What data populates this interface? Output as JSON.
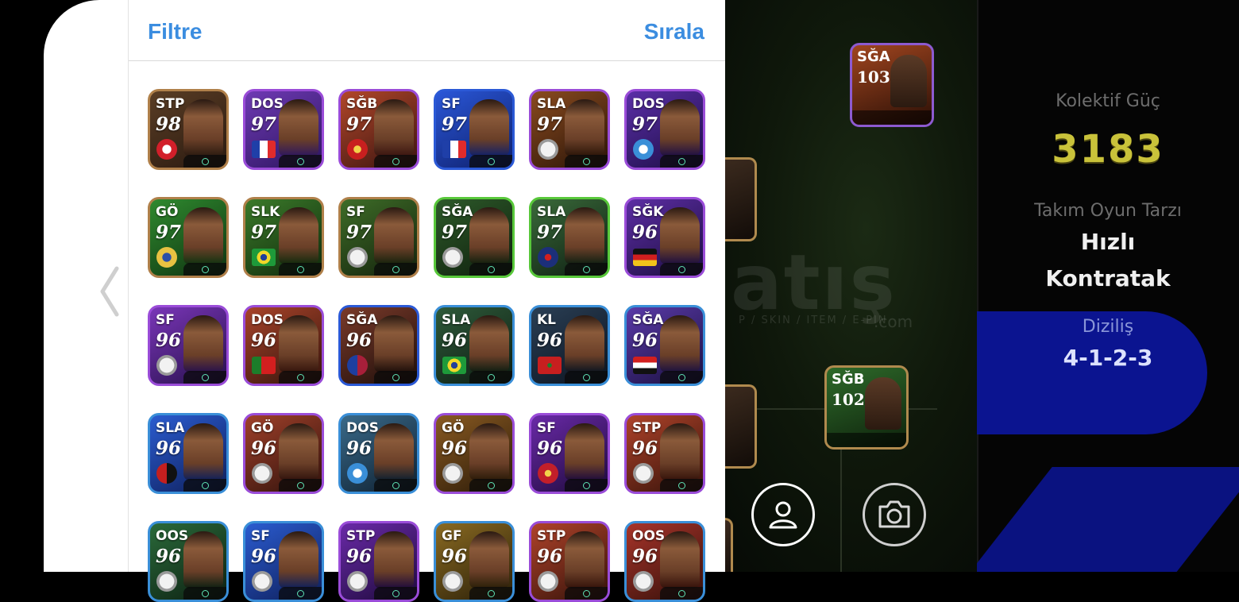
{
  "header": {
    "filter_label": "Filtre",
    "sort_label": "Sırala"
  },
  "side_panel": {
    "team_strength_label": "Kolektif Güç",
    "team_strength_value": "3183",
    "playstyle_label": "Takım Oyun Tarzı",
    "playstyle_line1": "Hızlı",
    "playstyle_line2": "Kontratak",
    "formation_label": "Diziliş",
    "formation_value": "4-1-2-3"
  },
  "field_cards": [
    {
      "position": "SĞA",
      "rating": "103"
    },
    {
      "position": "SĞB",
      "rating": "102"
    }
  ],
  "watermark": {
    "main": "atış",
    "sub": "P / SKIN / ITEM / E-PIN",
    "domain": ".com"
  },
  "icons": {
    "player_button": "person-icon",
    "camera_button": "camera-icon",
    "back": "chevron-left-icon"
  },
  "cards": [
    {
      "position": "STP",
      "rating": "98",
      "frame": "#b0804a",
      "bg": "#5a3d25",
      "bg2": "#2a1a10",
      "badge": "club-bayern"
    },
    {
      "position": "DOS",
      "rating": "97",
      "frame": "#9a4cd8",
      "bg": "#6f3ab4",
      "bg2": "#2c1560",
      "badge": "flag-france"
    },
    {
      "position": "SĞB",
      "rating": "97",
      "frame": "#9a4cd8",
      "bg": "#b2472a",
      "bg2": "#3a1410",
      "badge": "club-arsenal"
    },
    {
      "position": "SF",
      "rating": "97",
      "frame": "#2b59d6",
      "bg": "#2a57d8",
      "bg2": "#0e1f6b",
      "badge": "flag-france"
    },
    {
      "position": "SLA",
      "rating": "97",
      "frame": "#9a4cd8",
      "bg": "#8a4b1f",
      "bg2": "#2a1408",
      "badge": "club-white"
    },
    {
      "position": "DOS",
      "rating": "97",
      "frame": "#9a4cd8",
      "bg": "#5b2fa8",
      "bg2": "#1c0d45",
      "badge": "club-blue"
    },
    {
      "position": "GÖ",
      "rating": "97",
      "frame": "#b0804a",
      "bg": "#2f8a2f",
      "bg2": "#0f3310",
      "badge": "club-gold"
    },
    {
      "position": "SLK",
      "rating": "97",
      "frame": "#b0804a",
      "bg": "#3b7a2a",
      "bg2": "#102a0c",
      "badge": "flag-brazil"
    },
    {
      "position": "SF",
      "rating": "97",
      "frame": "#b0804a",
      "bg": "#3e6d28",
      "bg2": "#14220c",
      "badge": "club-white"
    },
    {
      "position": "SĞA",
      "rating": "97",
      "frame": "#58c83a",
      "bg": "#2d5a2a",
      "bg2": "#0f1f0d",
      "badge": "club-white"
    },
    {
      "position": "SLA",
      "rating": "97",
      "frame": "#58c83a",
      "bg": "#3a6a3a",
      "bg2": "#0e1f12",
      "badge": "club-psg"
    },
    {
      "position": "SĞK",
      "rating": "96",
      "frame": "#9a4cd8",
      "bg": "#5d2ea4",
      "bg2": "#1b0d40",
      "badge": "flag-germany"
    },
    {
      "position": "SF",
      "rating": "96",
      "frame": "#9a4cd8",
      "bg": "#7a36b8",
      "bg2": "#27104c",
      "badge": "club-white"
    },
    {
      "position": "DOS",
      "rating": "96",
      "frame": "#9a4cd8",
      "bg": "#a8432a",
      "bg2": "#34140c",
      "badge": "flag-portugal"
    },
    {
      "position": "SĞA",
      "rating": "96",
      "frame": "#2b59d6",
      "bg": "#7a3a2a",
      "bg2": "#1d0e0a",
      "badge": "club-barca"
    },
    {
      "position": "SLA",
      "rating": "96",
      "frame": "#3a8fd8",
      "bg": "#2e5a3a",
      "bg2": "#0d1d12",
      "badge": "flag-brazil"
    },
    {
      "position": "KL",
      "rating": "96",
      "frame": "#3a8fd8",
      "bg": "#2a3f55",
      "bg2": "#0c1420",
      "badge": "flag-morocco"
    },
    {
      "position": "SĞA",
      "rating": "96",
      "frame": "#3a8fd8",
      "bg": "#5a3aa8",
      "bg2": "#1a1040",
      "badge": "flag-egypt"
    },
    {
      "position": "SLA",
      "rating": "96",
      "frame": "#3a8fd8",
      "bg": "#2b5cd0",
      "bg2": "#0e1f5b",
      "badge": "club-milan"
    },
    {
      "position": "GÖ",
      "rating": "96",
      "frame": "#9a4cd8",
      "bg": "#a0402a",
      "bg2": "#30120c",
      "badge": "club-white"
    },
    {
      "position": "DOS",
      "rating": "96",
      "frame": "#3a8fd8",
      "bg": "#3a6a8a",
      "bg2": "#0e2030",
      "badge": "club-blue"
    },
    {
      "position": "GÖ",
      "rating": "96",
      "frame": "#9a4cd8",
      "bg": "#8a5a22",
      "bg2": "#2a1a08",
      "badge": "club-white"
    },
    {
      "position": "SF",
      "rating": "96",
      "frame": "#9a4cd8",
      "bg": "#6a2aa8",
      "bg2": "#1e0a3c",
      "badge": "club-red"
    },
    {
      "position": "STP",
      "rating": "96",
      "frame": "#9a4cd8",
      "bg": "#b0432a",
      "bg2": "#34120a",
      "badge": "club-white"
    },
    {
      "position": "OOS",
      "rating": "96",
      "frame": "#3a8fd8",
      "bg": "#2a6a3a",
      "bg2": "#0d2012",
      "badge": "club-white"
    },
    {
      "position": "SF",
      "rating": "96",
      "frame": "#3a8fd8",
      "bg": "#2b5cd0",
      "bg2": "#0e1f5b",
      "badge": "club-white"
    },
    {
      "position": "STP",
      "rating": "96",
      "frame": "#9a4cd8",
      "bg": "#6a2aa8",
      "bg2": "#1e0a3c",
      "badge": "club-white"
    },
    {
      "position": "GF",
      "rating": "96",
      "frame": "#3a8fd8",
      "bg": "#8a6a22",
      "bg2": "#2a1f08",
      "badge": "club-white"
    },
    {
      "position": "STP",
      "rating": "96",
      "frame": "#9a4cd8",
      "bg": "#b0432a",
      "bg2": "#34120a",
      "badge": "club-white"
    },
    {
      "position": "OOS",
      "rating": "96",
      "frame": "#3a8fd8",
      "bg": "#a8342a",
      "bg2": "#34100a",
      "badge": "club-white"
    }
  ]
}
